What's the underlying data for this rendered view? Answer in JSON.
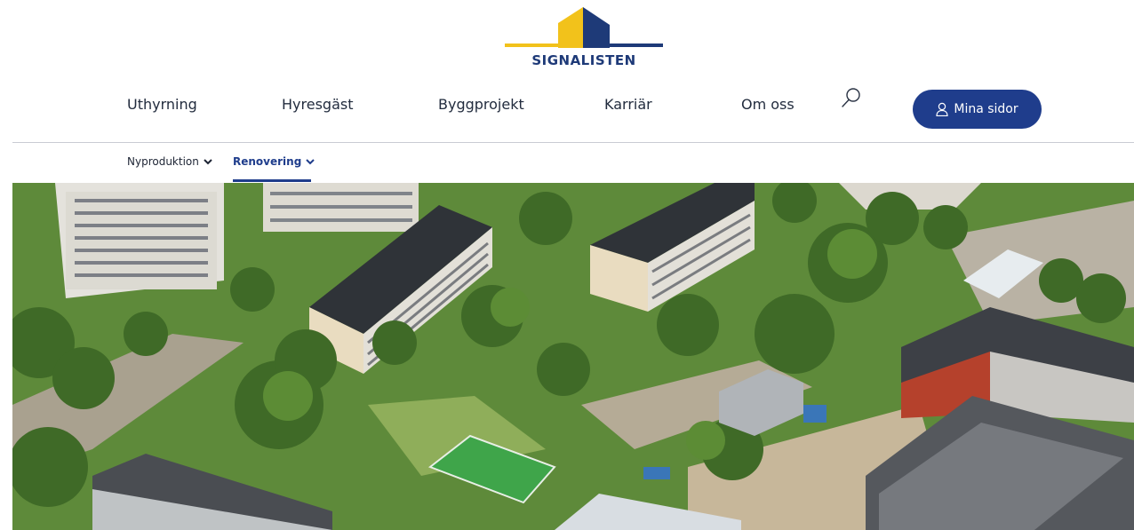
{
  "brand": {
    "name": "SIGNALISTEN",
    "colors": {
      "yellow": "#f2c21b",
      "navy": "#1e3a78",
      "button": "#1f3d8c"
    }
  },
  "nav": {
    "items": [
      "Uthyrning",
      "Hyresgäst",
      "Byggprojekt",
      "Karriär",
      "Om oss"
    ],
    "search_icon": "search-icon",
    "account_button": "Mina sidor",
    "account_icon": "user-icon"
  },
  "subnav": {
    "items": [
      {
        "label": "Nyproduktion",
        "active": false
      },
      {
        "label": "Renovering",
        "active": true
      }
    ],
    "chevron_icon": "chevron-down-icon"
  },
  "hero": {
    "image": "aerial-view-of-residential-area"
  }
}
